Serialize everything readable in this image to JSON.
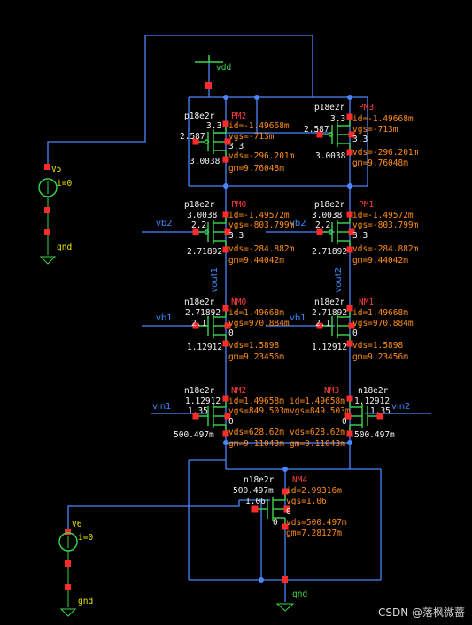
{
  "colors": {
    "background": "#000000",
    "wire": "#4a86ff",
    "device": "#3ad94a",
    "pin": "#ff2a2a",
    "annotation": "#ff8c1a",
    "node": "#f2f2f2",
    "source": "#e8e800"
  },
  "supply": {
    "label": "vdd"
  },
  "sources": [
    {
      "name": "V5",
      "value": "i=0",
      "gnd": "gnd"
    },
    {
      "name": "V6",
      "value": "i=0",
      "gnd": "gnd"
    }
  ],
  "ground_labels": {
    "tail": "gnd"
  },
  "nets": {
    "vb2": "vb2",
    "vb2_right": "vb2",
    "vb1": "vb1",
    "vb1_right": "vb1",
    "vin1": "vin1",
    "vin2": "vin2",
    "vout1": "vout1",
    "vout2": "vout2"
  },
  "devices": {
    "pm2": {
      "model": "p18e2r",
      "name": "PM2",
      "node_s": "3.3",
      "node_g": "2.587",
      "node_d": "3.0038",
      "node_b": "3.3",
      "id": "id=-1.49668m",
      "vgs": "vgs=-713m",
      "vds": "vds=-296.201m",
      "gm": "gm=9.76048m"
    },
    "pm3": {
      "model": "p18e2r",
      "name": "PM3",
      "node_s": "3.3",
      "node_g": "2.587",
      "node_d": "3.0038",
      "node_b": "3.3",
      "id": "id=-1.49668m",
      "vgs": "vgs=-713m",
      "vds": "vds=-296.201m",
      "gm": "gm=9.76048m"
    },
    "pm0": {
      "model": "p18e2r",
      "name": "PM0",
      "node_s": "3.0038",
      "node_g": "2.2",
      "node_d": "2.71892",
      "node_b": "3.3",
      "id": "id=-1.49572m",
      "vgs": "vgs=-803.799m",
      "vds": "vds=-284.882m",
      "gm": "gm=9.44042m"
    },
    "pm1": {
      "model": "p18e2r",
      "name": "PM1",
      "node_s": "3.0038",
      "node_g": "2.2",
      "node_d": "2.71892",
      "node_b": "3.3",
      "id": "id=-1.49572m",
      "vgs": "vgs=-803.799m",
      "vds": "vds=-284.882m",
      "gm": "gm=9.44042m"
    },
    "nm0": {
      "model": "n18e2r",
      "name": "NM0",
      "node_d": "2.71892",
      "node_g": "2.1",
      "node_s": "1.12912",
      "node_b": "0",
      "id": "id=1.49668m",
      "vgs": "vgs=970.884m",
      "vds": "vds=1.5898",
      "gm": "gm=9.23456m"
    },
    "nm1": {
      "model": "n18e2r",
      "name": "NM1",
      "node_d": "2.71892",
      "node_g": "2.1",
      "node_s": "1.12912",
      "node_b": "0",
      "id": "id=1.49668m",
      "vgs": "vgs=970.884m",
      "vds": "vds=1.5898",
      "gm": "gm=9.23456m"
    },
    "nm2": {
      "model": "n18e2r",
      "name": "NM2",
      "node_d": "1.12912",
      "node_g": "1.35",
      "node_s": "500.497m",
      "node_b": "0",
      "id": "id=1.49658m",
      "vgs": "vgs=849.503m",
      "vds": "vds=628.62m",
      "gm": "gm=9.11043m"
    },
    "nm3": {
      "model": "n18e2r",
      "name": "NM3",
      "node_d": "1.12912",
      "node_g": "1.35",
      "node_s": "500.497m",
      "node_b": "0",
      "id": "id=1.49658m",
      "vgs": "vgs=849.503m",
      "vds": "vds=628.62m",
      "gm": "gm=9.11043m"
    },
    "nm4": {
      "model": "n18e2r",
      "name": "NM4",
      "node_d": "500.497m",
      "node_g": "1.06",
      "node_s": "0",
      "node_b": "0",
      "id": "id=2.99316m",
      "vgs": "vgs=1.06",
      "vds": "vds=500.497m",
      "gm": "gm=7.28127m"
    }
  },
  "watermark": "CSDN @落枫微蔷"
}
